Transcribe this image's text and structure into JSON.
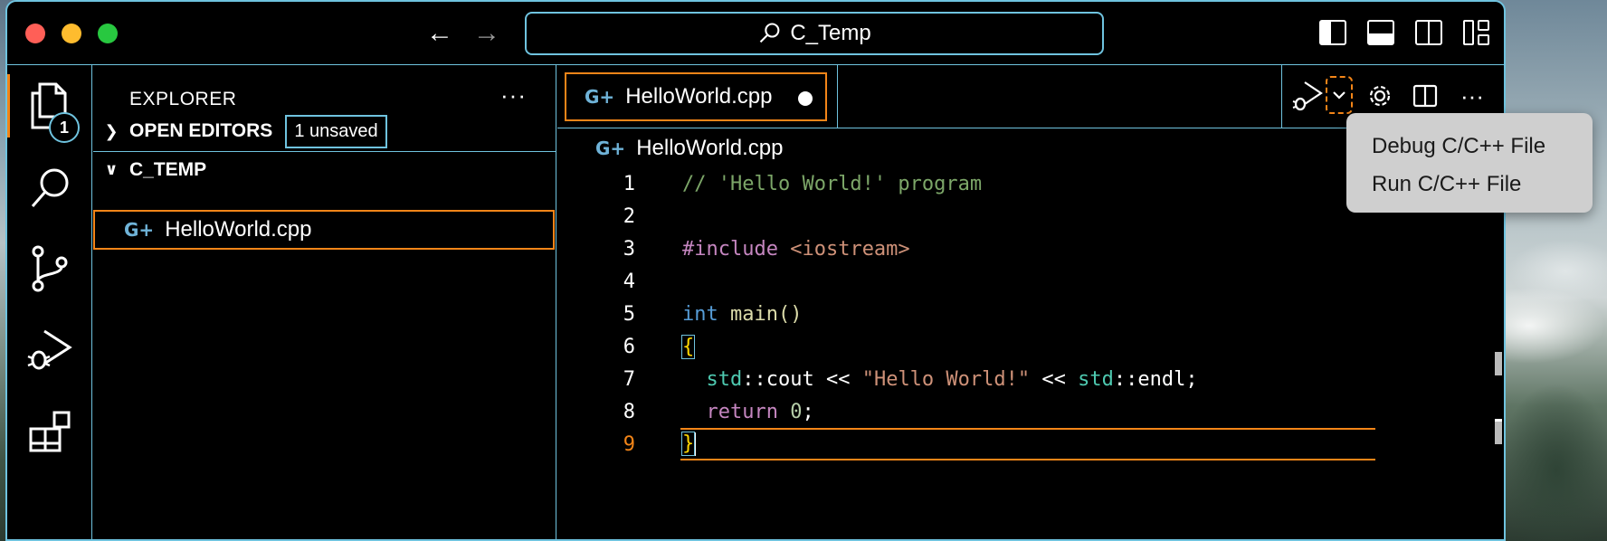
{
  "window": {
    "search_text": "C_Temp"
  },
  "activity_bar": {
    "explorer_badge": "1"
  },
  "sidebar": {
    "title": "EXPLORER",
    "more": "···",
    "open_editors": {
      "label": "OPEN EDITORS",
      "unsaved_badge": "1 unsaved"
    },
    "folder": {
      "label": "C_TEMP",
      "files": [
        "HelloWorld.cpp"
      ]
    }
  },
  "editor": {
    "tab": {
      "label": "HelloWorld.cpp",
      "dirty": true
    },
    "breadcrumb": "HelloWorld.cpp",
    "more": "···",
    "lines": [
      {
        "n": "1"
      },
      {
        "n": "2"
      },
      {
        "n": "3"
      },
      {
        "n": "4"
      },
      {
        "n": "5"
      },
      {
        "n": "6"
      },
      {
        "n": "7"
      },
      {
        "n": "8"
      },
      {
        "n": "9"
      }
    ],
    "code": {
      "l1": "// 'Hello World!' program",
      "l3_kw": "#include",
      "l3_inc": "<iostream>",
      "l5_type": "int",
      "l5_fn": "main",
      "l5_paren": "()",
      "l6": "{",
      "l7_ns1": "std",
      "l7_op1": "::cout << ",
      "l7_str": "\"Hello World!\"",
      "l7_op2": " << ",
      "l7_ns2": "std",
      "l7_op3": "::endl;",
      "l8_kw": "return",
      "l8_num": "0",
      "l8_semi": ";",
      "l9": "}"
    },
    "current_line": 9
  },
  "run_menu": {
    "items": [
      "Debug C/C++ File",
      "Run C/C++ File"
    ]
  },
  "colors": {
    "accent_border": "#6fc3df",
    "focus_border": "#f38518"
  }
}
